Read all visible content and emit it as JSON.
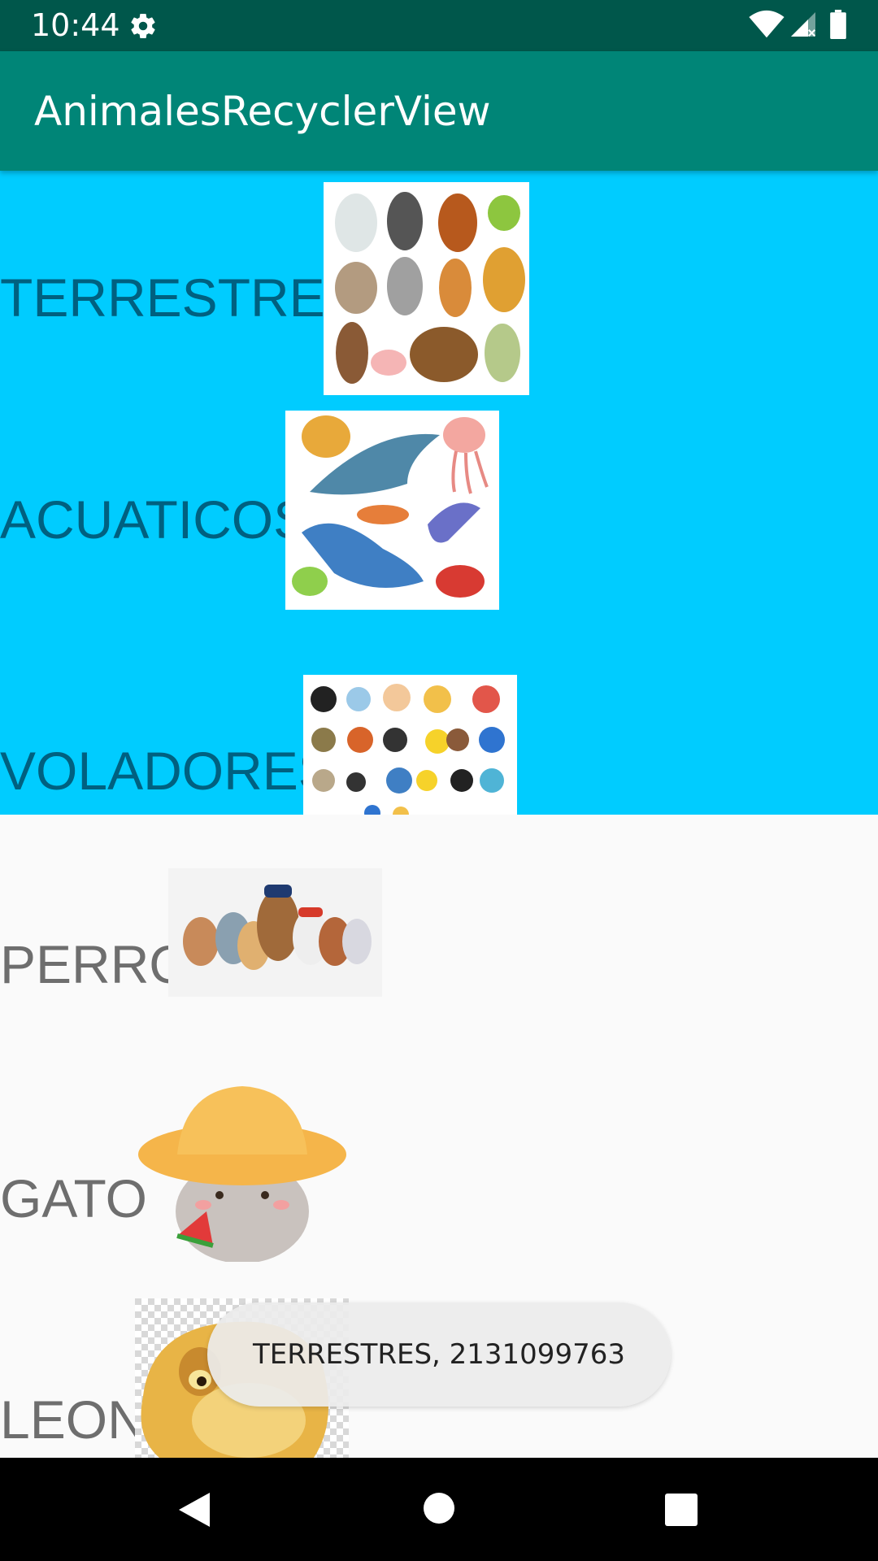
{
  "status_bar": {
    "time": "10:44",
    "icons": [
      "gear-icon",
      "wifi-icon",
      "signal-icon",
      "battery-icon"
    ]
  },
  "app_bar": {
    "title": "AnimalesRecyclerView",
    "color": "#008577"
  },
  "list": {
    "items": [
      {
        "label": "TERRESTRES",
        "image": "land-animals-collage",
        "highlighted": true
      },
      {
        "label": "ACUATICOS",
        "image": "sea-animals-collage",
        "highlighted": true
      },
      {
        "label": "VOLADORES",
        "image": "birds-collage",
        "highlighted": true
      },
      {
        "label": "PERRO",
        "image": "cartoon-dogs",
        "highlighted": false
      },
      {
        "label": "GATO",
        "image": "cartoon-cat-with-hat",
        "highlighted": false
      },
      {
        "label": "LEON",
        "image": "cartoon-lion-cub",
        "highlighted": false
      }
    ],
    "highlight_color": "#00ccff"
  },
  "toast": {
    "text": "TERRESTRES, 2131099763"
  },
  "nav_bar": {
    "icons": [
      "back-icon",
      "home-icon",
      "recents-icon"
    ]
  }
}
